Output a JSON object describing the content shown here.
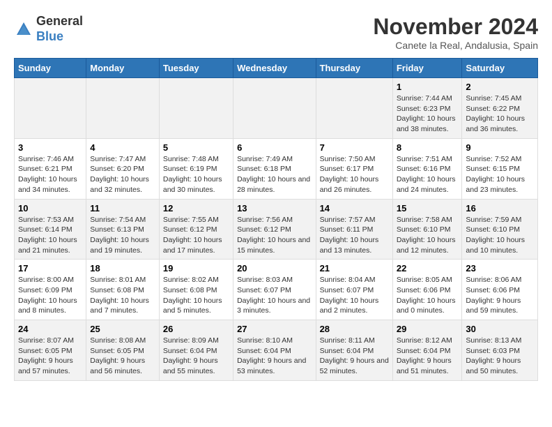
{
  "logo": {
    "general": "General",
    "blue": "Blue"
  },
  "title": "November 2024",
  "location": "Canete la Real, Andalusia, Spain",
  "days_of_week": [
    "Sunday",
    "Monday",
    "Tuesday",
    "Wednesday",
    "Thursday",
    "Friday",
    "Saturday"
  ],
  "weeks": [
    [
      {
        "day": "",
        "info": ""
      },
      {
        "day": "",
        "info": ""
      },
      {
        "day": "",
        "info": ""
      },
      {
        "day": "",
        "info": ""
      },
      {
        "day": "",
        "info": ""
      },
      {
        "day": "1",
        "info": "Sunrise: 7:44 AM\nSunset: 6:23 PM\nDaylight: 10 hours and 38 minutes."
      },
      {
        "day": "2",
        "info": "Sunrise: 7:45 AM\nSunset: 6:22 PM\nDaylight: 10 hours and 36 minutes."
      }
    ],
    [
      {
        "day": "3",
        "info": "Sunrise: 7:46 AM\nSunset: 6:21 PM\nDaylight: 10 hours and 34 minutes."
      },
      {
        "day": "4",
        "info": "Sunrise: 7:47 AM\nSunset: 6:20 PM\nDaylight: 10 hours and 32 minutes."
      },
      {
        "day": "5",
        "info": "Sunrise: 7:48 AM\nSunset: 6:19 PM\nDaylight: 10 hours and 30 minutes."
      },
      {
        "day": "6",
        "info": "Sunrise: 7:49 AM\nSunset: 6:18 PM\nDaylight: 10 hours and 28 minutes."
      },
      {
        "day": "7",
        "info": "Sunrise: 7:50 AM\nSunset: 6:17 PM\nDaylight: 10 hours and 26 minutes."
      },
      {
        "day": "8",
        "info": "Sunrise: 7:51 AM\nSunset: 6:16 PM\nDaylight: 10 hours and 24 minutes."
      },
      {
        "day": "9",
        "info": "Sunrise: 7:52 AM\nSunset: 6:15 PM\nDaylight: 10 hours and 23 minutes."
      }
    ],
    [
      {
        "day": "10",
        "info": "Sunrise: 7:53 AM\nSunset: 6:14 PM\nDaylight: 10 hours and 21 minutes."
      },
      {
        "day": "11",
        "info": "Sunrise: 7:54 AM\nSunset: 6:13 PM\nDaylight: 10 hours and 19 minutes."
      },
      {
        "day": "12",
        "info": "Sunrise: 7:55 AM\nSunset: 6:12 PM\nDaylight: 10 hours and 17 minutes."
      },
      {
        "day": "13",
        "info": "Sunrise: 7:56 AM\nSunset: 6:12 PM\nDaylight: 10 hours and 15 minutes."
      },
      {
        "day": "14",
        "info": "Sunrise: 7:57 AM\nSunset: 6:11 PM\nDaylight: 10 hours and 13 minutes."
      },
      {
        "day": "15",
        "info": "Sunrise: 7:58 AM\nSunset: 6:10 PM\nDaylight: 10 hours and 12 minutes."
      },
      {
        "day": "16",
        "info": "Sunrise: 7:59 AM\nSunset: 6:10 PM\nDaylight: 10 hours and 10 minutes."
      }
    ],
    [
      {
        "day": "17",
        "info": "Sunrise: 8:00 AM\nSunset: 6:09 PM\nDaylight: 10 hours and 8 minutes."
      },
      {
        "day": "18",
        "info": "Sunrise: 8:01 AM\nSunset: 6:08 PM\nDaylight: 10 hours and 7 minutes."
      },
      {
        "day": "19",
        "info": "Sunrise: 8:02 AM\nSunset: 6:08 PM\nDaylight: 10 hours and 5 minutes."
      },
      {
        "day": "20",
        "info": "Sunrise: 8:03 AM\nSunset: 6:07 PM\nDaylight: 10 hours and 3 minutes."
      },
      {
        "day": "21",
        "info": "Sunrise: 8:04 AM\nSunset: 6:07 PM\nDaylight: 10 hours and 2 minutes."
      },
      {
        "day": "22",
        "info": "Sunrise: 8:05 AM\nSunset: 6:06 PM\nDaylight: 10 hours and 0 minutes."
      },
      {
        "day": "23",
        "info": "Sunrise: 8:06 AM\nSunset: 6:06 PM\nDaylight: 9 hours and 59 minutes."
      }
    ],
    [
      {
        "day": "24",
        "info": "Sunrise: 8:07 AM\nSunset: 6:05 PM\nDaylight: 9 hours and 57 minutes."
      },
      {
        "day": "25",
        "info": "Sunrise: 8:08 AM\nSunset: 6:05 PM\nDaylight: 9 hours and 56 minutes."
      },
      {
        "day": "26",
        "info": "Sunrise: 8:09 AM\nSunset: 6:04 PM\nDaylight: 9 hours and 55 minutes."
      },
      {
        "day": "27",
        "info": "Sunrise: 8:10 AM\nSunset: 6:04 PM\nDaylight: 9 hours and 53 minutes."
      },
      {
        "day": "28",
        "info": "Sunrise: 8:11 AM\nSunset: 6:04 PM\nDaylight: 9 hours and 52 minutes."
      },
      {
        "day": "29",
        "info": "Sunrise: 8:12 AM\nSunset: 6:04 PM\nDaylight: 9 hours and 51 minutes."
      },
      {
        "day": "30",
        "info": "Sunrise: 8:13 AM\nSunset: 6:03 PM\nDaylight: 9 hours and 50 minutes."
      }
    ]
  ]
}
